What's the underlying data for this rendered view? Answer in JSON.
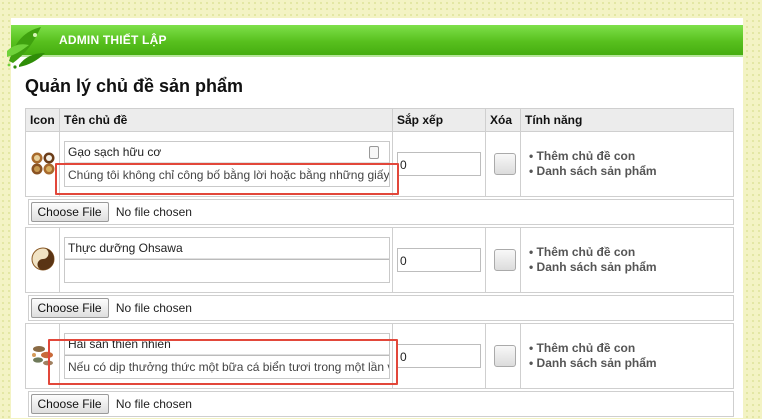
{
  "header": {
    "title": "ADMIN THIẾT LẬP"
  },
  "page": {
    "title": "Quản lý chủ đề sản phẩm"
  },
  "table": {
    "columns": [
      "Icon",
      "Tên chủ đề",
      "Sắp xếp",
      "Xóa",
      "Tính năng"
    ],
    "rows": [
      {
        "name": "Gạo sạch hữu cơ",
        "description": "Chúng tôi không chỉ công bố bằng lời hoặc bằng những giấy",
        "sort": "0",
        "icon": "rice-bowls-icon",
        "features": [
          "• Thêm chủ đề con",
          "• Danh sách sản phẩm"
        ],
        "file_button": "Choose File",
        "file_status": "No file chosen"
      },
      {
        "name": "Thực dưỡng Ohsawa",
        "description": "",
        "sort": "0",
        "icon": "yin-yang-icon",
        "features": [
          "• Thêm chủ đề con",
          "• Danh sách sản phẩm"
        ],
        "file_button": "Choose File",
        "file_status": "No file chosen"
      },
      {
        "name": "Hải sản thiên nhiên",
        "description": "Nếu có dịp thưởng thức một bữa cá biển tươi trong một lần v",
        "sort": "0",
        "icon": "seafood-icon",
        "features": [
          "• Thêm chủ đề con",
          "• Danh sách sản phẩm"
        ],
        "file_button": "Choose File",
        "file_status": "No file chosen"
      }
    ]
  },
  "colors": {
    "header_green": "#58c01e",
    "highlight_red": "#e2473a",
    "feature_text": "#555555"
  }
}
